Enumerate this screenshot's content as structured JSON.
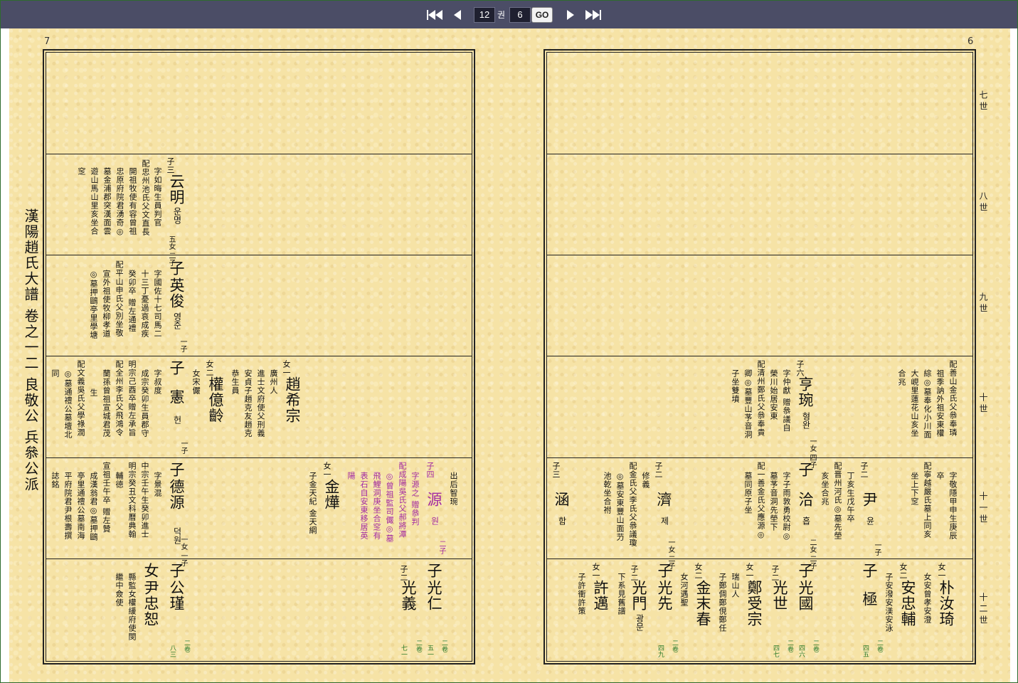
{
  "toolbar": {
    "volume": "12",
    "volume_unit": "권",
    "page": "6",
    "go_label": "GO"
  },
  "side_title": "漢陽趙氏大譜 卷之一二 良敬公 兵叅公派",
  "left_page_number": "7",
  "right_page_number": "6",
  "generations": [
    "七世",
    "八世",
    "九世",
    "十世",
    "十一世",
    "十二世"
  ],
  "left": {
    "r8": {
      "c1_label": "子三",
      "c1_name": "云明",
      "c1_ko": "운명",
      "c1_kids": "五女 二子",
      "c1_info": [
        "字如晦生員判官",
        "配忠州池氏父文直長",
        "開祖牧使有容曾祖",
        "忠原府院君湧奇◎",
        "墓金浦郡突漢面雲",
        "遊山馬山里亥坐合",
        "窆"
      ]
    },
    "r9": {
      "c1_label": "子",
      "c1_name": "英俊",
      "c1_ko": "영준",
      "c1_kids": "一子",
      "c1_info": [
        "字國佐十七司馬二",
        "十三丁憂過哀成疾",
        "癸卯卒 贈左通禮",
        "配平山申氏父別坐敬",
        "宣外祖使牧柳孝道",
        "◎墓押鷗亭里學塘"
      ]
    },
    "r10": {
      "f1_label": "女一",
      "f1_name": "趙希宗",
      "f1_info": [
        "廣州人",
        "進士文府使父刑義",
        "安貞子趙克友趙克",
        "恭生員"
      ],
      "f2_label": "女二",
      "f2_name": "權億齡",
      "f2_info": [
        "女宋儼"
      ],
      "c1_label": "子",
      "c1_name": "憲",
      "c1_ko": "헌",
      "c1_kids": "一子",
      "c1_info": [
        "字叔度",
        "成宗癸卯生員郡守",
        "明宗己酉卒贈左承旨",
        "配全州李氏父飛鴻令",
        "蘭孫曾祖宣城君茂",
        "生",
        "配文義吳氏父學祿潤",
        "◎墓通禮公墓壇北",
        "同"
      ]
    },
    "r11": {
      "c1_label": "子四",
      "c1_name": "源",
      "c1_ko": "원",
      "c1_kids": "二子",
      "c1_info": [
        "字源之 贈叅判",
        "配成陽吳氏父郝將潭",
        "◎曾祖監司儼◎墓",
        "飛鯉洞庚坐合窆有",
        "表石自安東移居英",
        "陽"
      ],
      "c1_note": [
        "出后智琬"
      ],
      "f1_label": "女一",
      "f1_name": "金燁",
      "f1_info": [
        "子金天紀 金天綱"
      ],
      "c2_label": "子",
      "c2_name": "德源",
      "c2_ko": "덕원",
      "c2_kids": "一女 一子",
      "c2_info": [
        "字景混",
        "中宗壬午生癸卯進士",
        "明宗癸丑文科曆典翰",
        "輔德",
        "宣祖壬午卒 贈左贊",
        "成漢翁君◎墓押鷗",
        "亭里通禮公墓南海",
        "平府院君尹根壽撰",
        "誌銘"
      ]
    },
    "r12": {
      "a_label": "子",
      "a_name": "光仁",
      "a_ref": "二卷",
      "a_page": "五一",
      "b_label": "子二",
      "b_name": "光義",
      "b_ref": "二卷",
      "b_page": "七一",
      "c_label": "子",
      "c_name": "公瑾",
      "c_ref": "二卷",
      "c_page": "八三",
      "d_label": "女",
      "d_name": "尹忠恕",
      "d_info": [
        "縣監女權緩府使閔",
        "繼中僉使"
      ]
    }
  },
  "right": {
    "r10": {
      "c1_label": "子六",
      "c1_name": "亨琬",
      "c1_ko": "형완",
      "c1_kids": "一女 四子",
      "c1_info": [
        "字仲獻 贈叅議自",
        "榮川始居安東",
        "配清州鄭氏父叅奉貴",
        "卿◎墓豐山芧音洞",
        "子坐雙墳"
      ],
      "c2_info": [
        "配善山金氏父叅奉璘",
        "祖季訥外祖安東權",
        "綜◎墓奉化小川面",
        "大峴里蓮花山亥坐",
        "合兆"
      ]
    },
    "r11": {
      "c1_label": "子三",
      "c1_name": "涵",
      "c1_ko": "함",
      "c2_label": "子二",
      "c2_name": "濟",
      "c2_ko": "제",
      "c2_kids": "一女 二子",
      "c2_info": [
        "修義",
        "配金氏父李氏父叅議瓊",
        "◎墓安東豐山面芀",
        "池乾坐合祔"
      ],
      "c3_label": "子",
      "c3_name": "洽",
      "c3_ko": "흡",
      "c3_kids": "二女 二子",
      "c3_info": [
        "字子雨敦勇校尉◎",
        "墓芧音洞先塋下",
        "配一善金氏父應源◎",
        "墓同原子坐"
      ],
      "c4_label": "子二",
      "c4_name": "尹",
      "c4_ko": "윤",
      "c4_kids": "一子",
      "c4_info": [
        "丁亥生戊午卒",
        "配晋州河氏◎墓先塋",
        "亥坐合兆"
      ],
      "c5_info": [
        "字敬隱甲申生庚辰",
        "卒",
        "配寧越嚴氏墓上同亥",
        "坐上下窆"
      ]
    },
    "r12": {
      "a_label": "女一",
      "a_name": "朴汝琦",
      "a_info": [
        "女安曾孝安澄"
      ],
      "b_label": "女二",
      "b_name": "安忠輔",
      "b_info": [
        "子安潑安渼安泳"
      ],
      "c_label": "子",
      "c_name": "極",
      "c_ref": "二卷",
      "c_page": "四五",
      "d_label": "子",
      "d_name": "光國",
      "d_ref": "二卷",
      "d_page": "四六",
      "e_label": "子二",
      "e_name": "光世",
      "e_ref": "二卷",
      "e_page": "四七",
      "f_label": "女一",
      "f_name": "鄭受宗",
      "f_info": [
        "瑞山人",
        "子鄭倜鄭俔鄭任"
      ],
      "g_label": "女二",
      "g_name": "金末春",
      "g_info": [
        "女河遇聖"
      ],
      "h_label": "子",
      "h_name": "光先",
      "h_ref": "二卷",
      "h_page": "四九",
      "i_label": "子二",
      "i_name": "光門",
      "i_ko": "광문",
      "i_info": [
        "下系見舊譜"
      ],
      "j_label": "女一",
      "j_name": "許邁",
      "j_info": [
        "子許衝許策"
      ]
    }
  }
}
